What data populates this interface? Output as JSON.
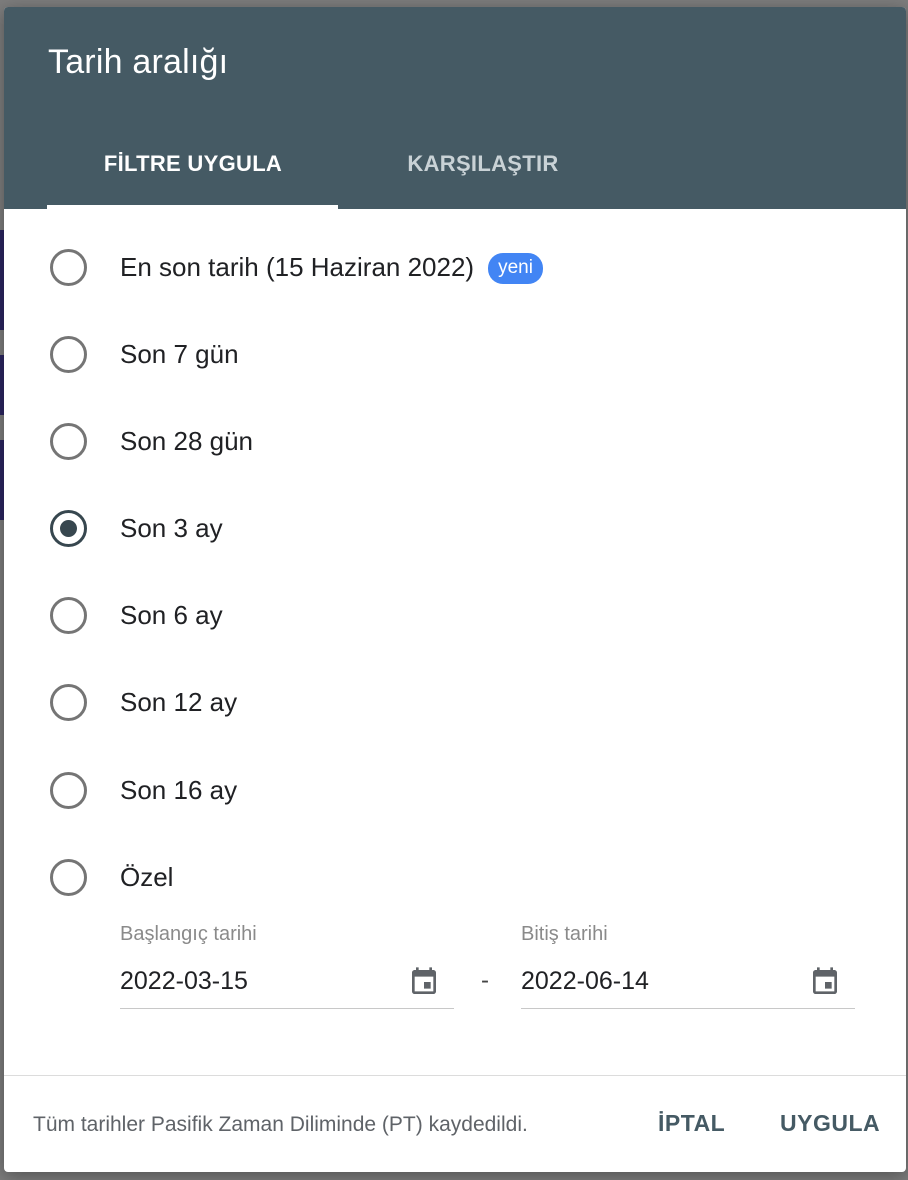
{
  "dialog": {
    "title": "Tarih aralığı",
    "tabs": [
      {
        "label": "FİLTRE UYGULA",
        "active": true
      },
      {
        "label": "KARŞILAŞTIR",
        "active": false
      }
    ],
    "options": [
      {
        "label": "En son tarih (15 Haziran 2022)",
        "badge": "yeni",
        "checked": false
      },
      {
        "label": "Son 7 gün",
        "checked": false
      },
      {
        "label": "Son 28 gün",
        "checked": false
      },
      {
        "label": "Son 3 ay",
        "checked": true
      },
      {
        "label": "Son 6 ay",
        "checked": false
      },
      {
        "label": "Son 12 ay",
        "checked": false
      },
      {
        "label": "Son 16 ay",
        "checked": false
      },
      {
        "label": "Özel",
        "checked": false
      }
    ],
    "custom_range": {
      "start_label": "Başlangıç tarihi",
      "start_value": "2022-03-15",
      "separator": "-",
      "end_label": "Bitiş tarihi",
      "end_value": "2022-06-14",
      "icon": "calendar-icon"
    },
    "footer": {
      "note": "Tüm tarihler Pasifik Zaman Diliminde (PT) kaydedildi.",
      "cancel_label": "İPTAL",
      "apply_label": "UYGULA"
    },
    "colors": {
      "header": "#455a64",
      "badge": "#4285f4",
      "radio_checked": "#37474f",
      "button_text": "#455a64"
    }
  }
}
